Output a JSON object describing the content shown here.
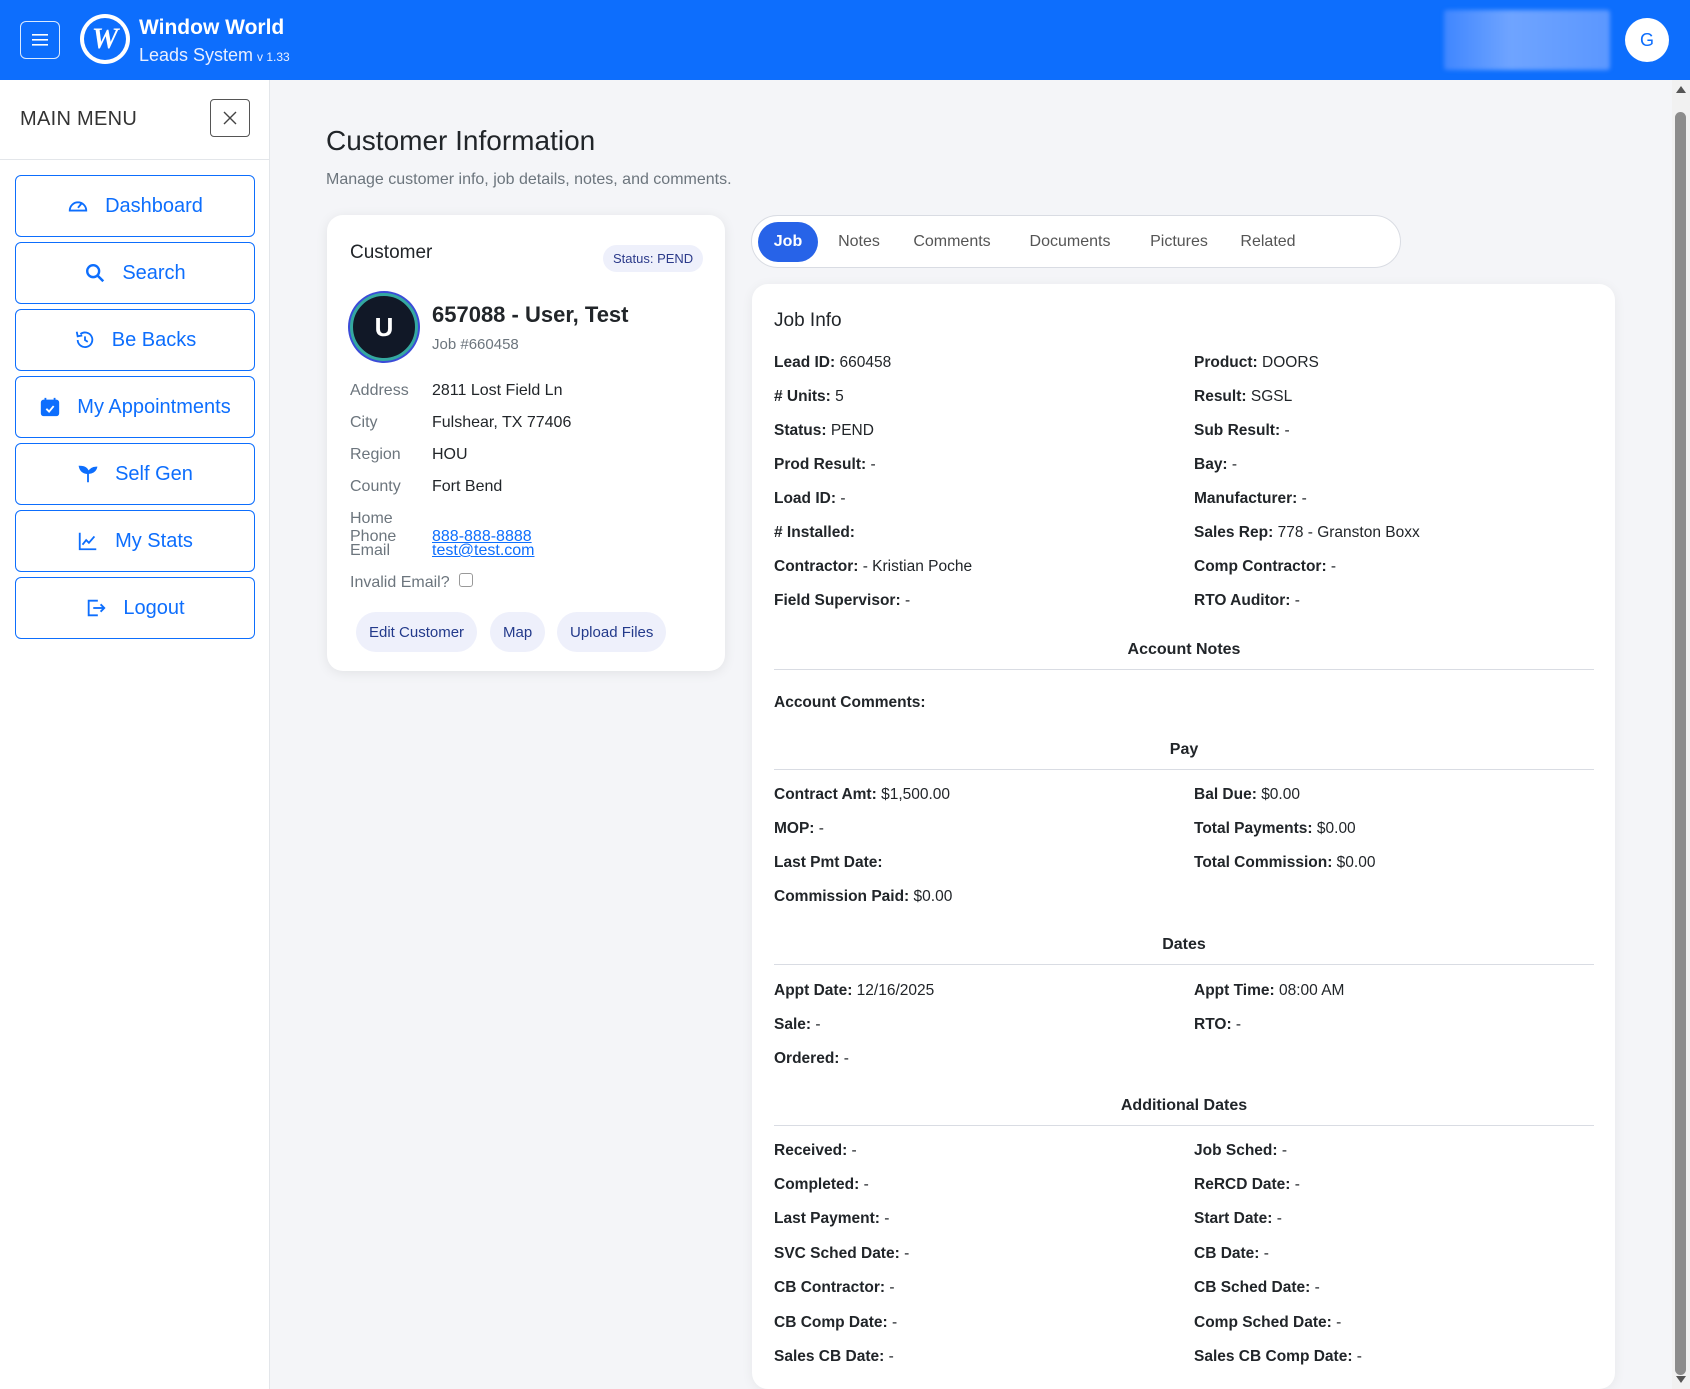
{
  "header": {
    "brand_title": "Window World",
    "brand_sub": "Leads System",
    "version": "v 1.33",
    "user_initial": "G",
    "menu_icon": "hamburger-icon",
    "logo_letter": "W"
  },
  "sidebar": {
    "title": "MAIN MENU",
    "items": [
      {
        "label": "Dashboard",
        "icon": "speedometer-icon"
      },
      {
        "label": "Search",
        "icon": "search-icon"
      },
      {
        "label": "Be Backs",
        "icon": "history-icon"
      },
      {
        "label": "My Appointments",
        "icon": "calendar-check-icon"
      },
      {
        "label": "Self Gen",
        "icon": "sprout-icon"
      },
      {
        "label": "My Stats",
        "icon": "graph-up-icon"
      },
      {
        "label": "Logout",
        "icon": "logout-icon"
      }
    ]
  },
  "page": {
    "title": "Customer Information",
    "subtitle": "Manage customer info, job details, notes, and comments."
  },
  "customer": {
    "heading": "Customer",
    "status": "Status: PEND",
    "initial": "U",
    "name": "657088 - User, Test",
    "job": "Job #660458",
    "fields": {
      "address_label": "Address",
      "address": "2811 Lost Field Ln",
      "city_label": "City",
      "city": "Fulshear, TX 77406",
      "region_label": "Region",
      "region": "HOU",
      "county_label": "County",
      "county": "Fort Bend",
      "phone_label": "Home Phone",
      "phone": "888-888-8888",
      "email_label": "Email",
      "email": "test@test.com",
      "invalid_email_label": "Invalid Email?"
    },
    "invalid_email_checked": false,
    "buttons": {
      "edit": "Edit Customer",
      "map": "Map",
      "upload": "Upload Files"
    }
  },
  "tabs": [
    "Job",
    "Notes",
    "Comments",
    "Documents",
    "Pictures",
    "Related"
  ],
  "active_tab": "Job",
  "job": {
    "title": "Job Info",
    "info_left": [
      {
        "k": "Lead ID:",
        "v": "660458"
      },
      {
        "k": "# Units:",
        "v": "5"
      },
      {
        "k": "Status:",
        "v": "PEND"
      },
      {
        "k": "Prod Result:",
        "v": "-"
      },
      {
        "k": "Load ID:",
        "v": "-"
      },
      {
        "k": "# Installed:",
        "v": ""
      },
      {
        "k": "Contractor:",
        "v": "- Kristian Poche"
      },
      {
        "k": "Field Supervisor:",
        "v": "-"
      }
    ],
    "info_right": [
      {
        "k": "Product:",
        "v": "DOORS"
      },
      {
        "k": "Result:",
        "v": "SGSL"
      },
      {
        "k": "Sub Result:",
        "v": "-"
      },
      {
        "k": "Bay:",
        "v": "-"
      },
      {
        "k": "Manufacturer:",
        "v": "-"
      },
      {
        "k": "Sales Rep:",
        "v": "778 - Granston Boxx"
      },
      {
        "k": "Comp Contractor:",
        "v": "-"
      },
      {
        "k": "RTO Auditor:",
        "v": "-"
      }
    ],
    "account_notes_head": "Account Notes",
    "account_comments": {
      "k": "Account Comments:",
      "v": ""
    },
    "pay_head": "Pay",
    "pay_left": [
      {
        "k": "Contract Amt:",
        "v": "$1,500.00"
      },
      {
        "k": "MOP:",
        "v": "-"
      },
      {
        "k": "Last Pmt Date:",
        "v": ""
      },
      {
        "k": "Commission Paid:",
        "v": "$0.00"
      }
    ],
    "pay_right": [
      {
        "k": "Bal Due:",
        "v": "$0.00"
      },
      {
        "k": "Total Payments:",
        "v": "$0.00"
      },
      {
        "k": "Total Commission:",
        "v": "$0.00"
      }
    ],
    "dates_head": "Dates",
    "dates_left": [
      {
        "k": "Appt Date:",
        "v": "12/16/2025"
      },
      {
        "k": "Sale:",
        "v": "-"
      },
      {
        "k": "Ordered:",
        "v": "-"
      }
    ],
    "dates_right": [
      {
        "k": "Appt Time:",
        "v": "08:00 AM"
      },
      {
        "k": "RTO:",
        "v": "-"
      }
    ],
    "add_dates_head": "Additional Dates",
    "add_left": [
      {
        "k": "Received:",
        "v": "-"
      },
      {
        "k": "Completed:",
        "v": "-"
      },
      {
        "k": "Last Payment:",
        "v": "-"
      },
      {
        "k": "SVC Sched Date:",
        "v": "-"
      },
      {
        "k": "CB Contractor:",
        "v": "-"
      },
      {
        "k": "CB Comp Date:",
        "v": "-"
      },
      {
        "k": "Sales CB Date:",
        "v": "-"
      }
    ],
    "add_right": [
      {
        "k": "Job Sched:",
        "v": "-"
      },
      {
        "k": "ReRCD Date:",
        "v": "-"
      },
      {
        "k": "Start Date:",
        "v": "-"
      },
      {
        "k": "CB Date:",
        "v": "-"
      },
      {
        "k": "CB Sched Date:",
        "v": "-"
      },
      {
        "k": "Comp Sched Date:",
        "v": "-"
      },
      {
        "k": "Sales CB Comp Date:",
        "v": "-"
      }
    ]
  },
  "colors": {
    "primary": "#0d6efd",
    "tab_active": "#2763e8",
    "pill_bg": "#eef0fb",
    "pill_text": "#233a8b"
  }
}
